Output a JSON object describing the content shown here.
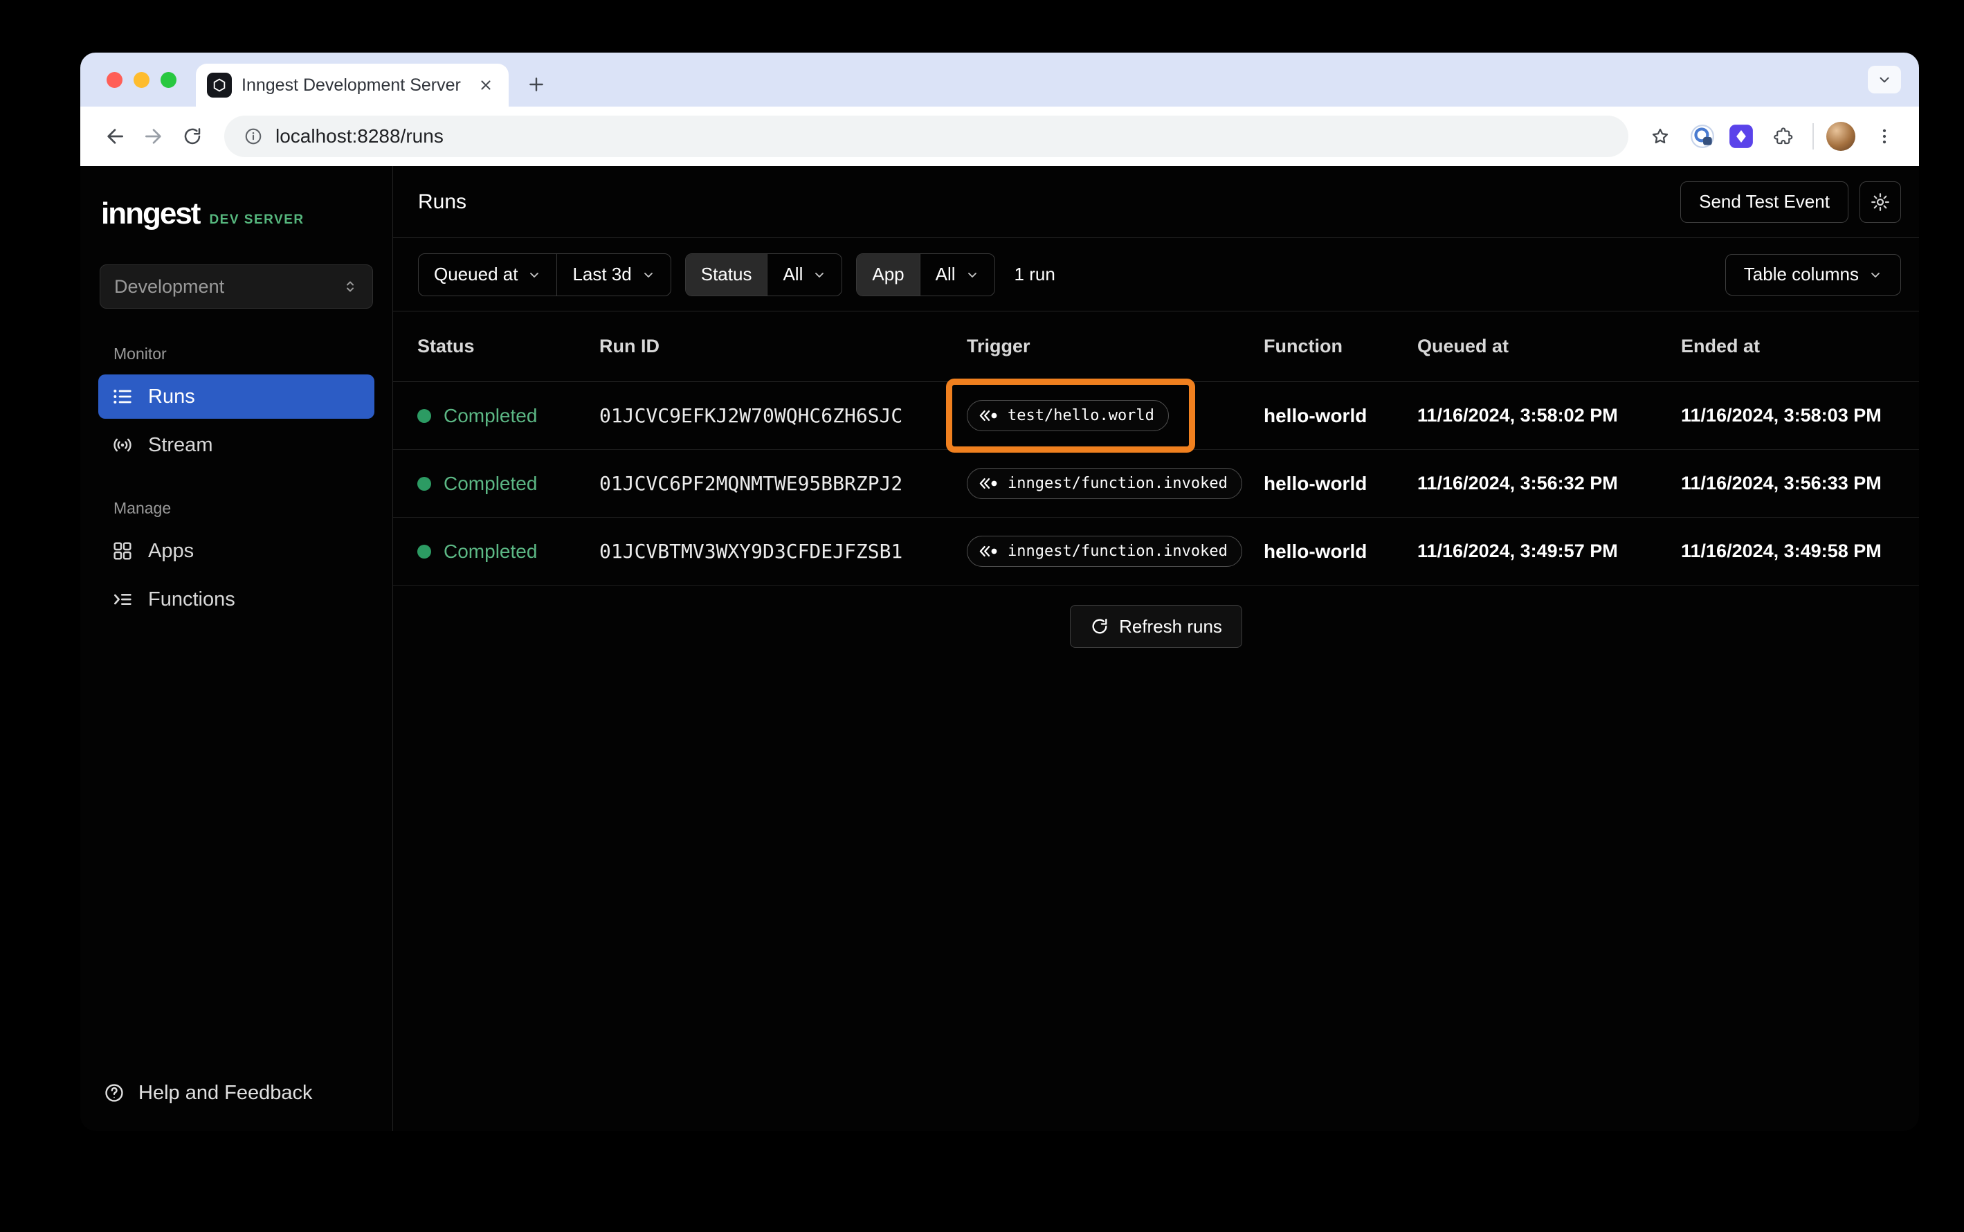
{
  "browser": {
    "tab_title": "Inngest Development Server",
    "url": "localhost:8288/runs"
  },
  "sidebar": {
    "logo_text": "inngest",
    "logo_badge": "DEV SERVER",
    "environment": "Development",
    "sections": [
      {
        "label": "Monitor",
        "items": [
          {
            "label": "Runs",
            "icon": "runs-icon",
            "active": true
          },
          {
            "label": "Stream",
            "icon": "stream-icon",
            "active": false
          }
        ]
      },
      {
        "label": "Manage",
        "items": [
          {
            "label": "Apps",
            "icon": "apps-icon",
            "active": false
          },
          {
            "label": "Functions",
            "icon": "functions-icon",
            "active": false
          }
        ]
      }
    ],
    "help_label": "Help and Feedback"
  },
  "header": {
    "title": "Runs",
    "send_test_event_label": "Send Test Event"
  },
  "filters": {
    "sort_field": "Queued at",
    "time_range": "Last 3d",
    "status_label": "Status",
    "status_value": "All",
    "app_label": "App",
    "app_value": "All",
    "run_count": "1 run",
    "table_columns_label": "Table columns"
  },
  "runs_table": {
    "columns": [
      "Status",
      "Run ID",
      "Trigger",
      "Function",
      "Queued at",
      "Ended at"
    ],
    "rows": [
      {
        "status": "Completed",
        "run_id": "01JCVC9EFKJ2W70WQHC6ZH6SJC",
        "trigger": "test/hello.world",
        "function": "hello-world",
        "queued_at": "11/16/2024, 3:58:02 PM",
        "ended_at": "11/16/2024, 3:58:03 PM",
        "annotated": true
      },
      {
        "status": "Completed",
        "run_id": "01JCVC6PF2MQNMTWE95BBRZPJ2",
        "trigger": "inngest/function.invoked",
        "function": "hello-world",
        "queued_at": "11/16/2024, 3:56:32 PM",
        "ended_at": "11/16/2024, 3:56:33 PM",
        "annotated": false
      },
      {
        "status": "Completed",
        "run_id": "01JCVBTMV3WXY9D3CFDEJFZSB1",
        "trigger": "inngest/function.invoked",
        "function": "hello-world",
        "queued_at": "11/16/2024, 3:49:57 PM",
        "ended_at": "11/16/2024, 3:49:58 PM",
        "annotated": false
      }
    ],
    "refresh_label": "Refresh runs"
  },
  "colors": {
    "accent_blue": "#2c5cc5",
    "status_green_dot": "#2c9b63",
    "status_green_text": "#5cb885",
    "dev_server_green": "#57b97f",
    "annotation_orange": "#f0801f",
    "tabstrip_bg": "#dbe3f7",
    "app_bg": "#030303"
  },
  "icons": [
    "traffic-close-icon",
    "traffic-minimize-icon",
    "traffic-zoom-icon",
    "inngest-favicon",
    "close-icon",
    "plus-icon",
    "chevron-down-icon",
    "back-icon",
    "forward-icon",
    "reload-icon",
    "info-icon",
    "star-icon",
    "extension-icon",
    "puzzle-icon",
    "avatar",
    "kebab-menu-icon",
    "updown-chevron-icon",
    "runs-icon",
    "stream-icon",
    "apps-icon",
    "functions-icon",
    "help-icon",
    "gear-icon",
    "event-icon",
    "refresh-icon"
  ]
}
